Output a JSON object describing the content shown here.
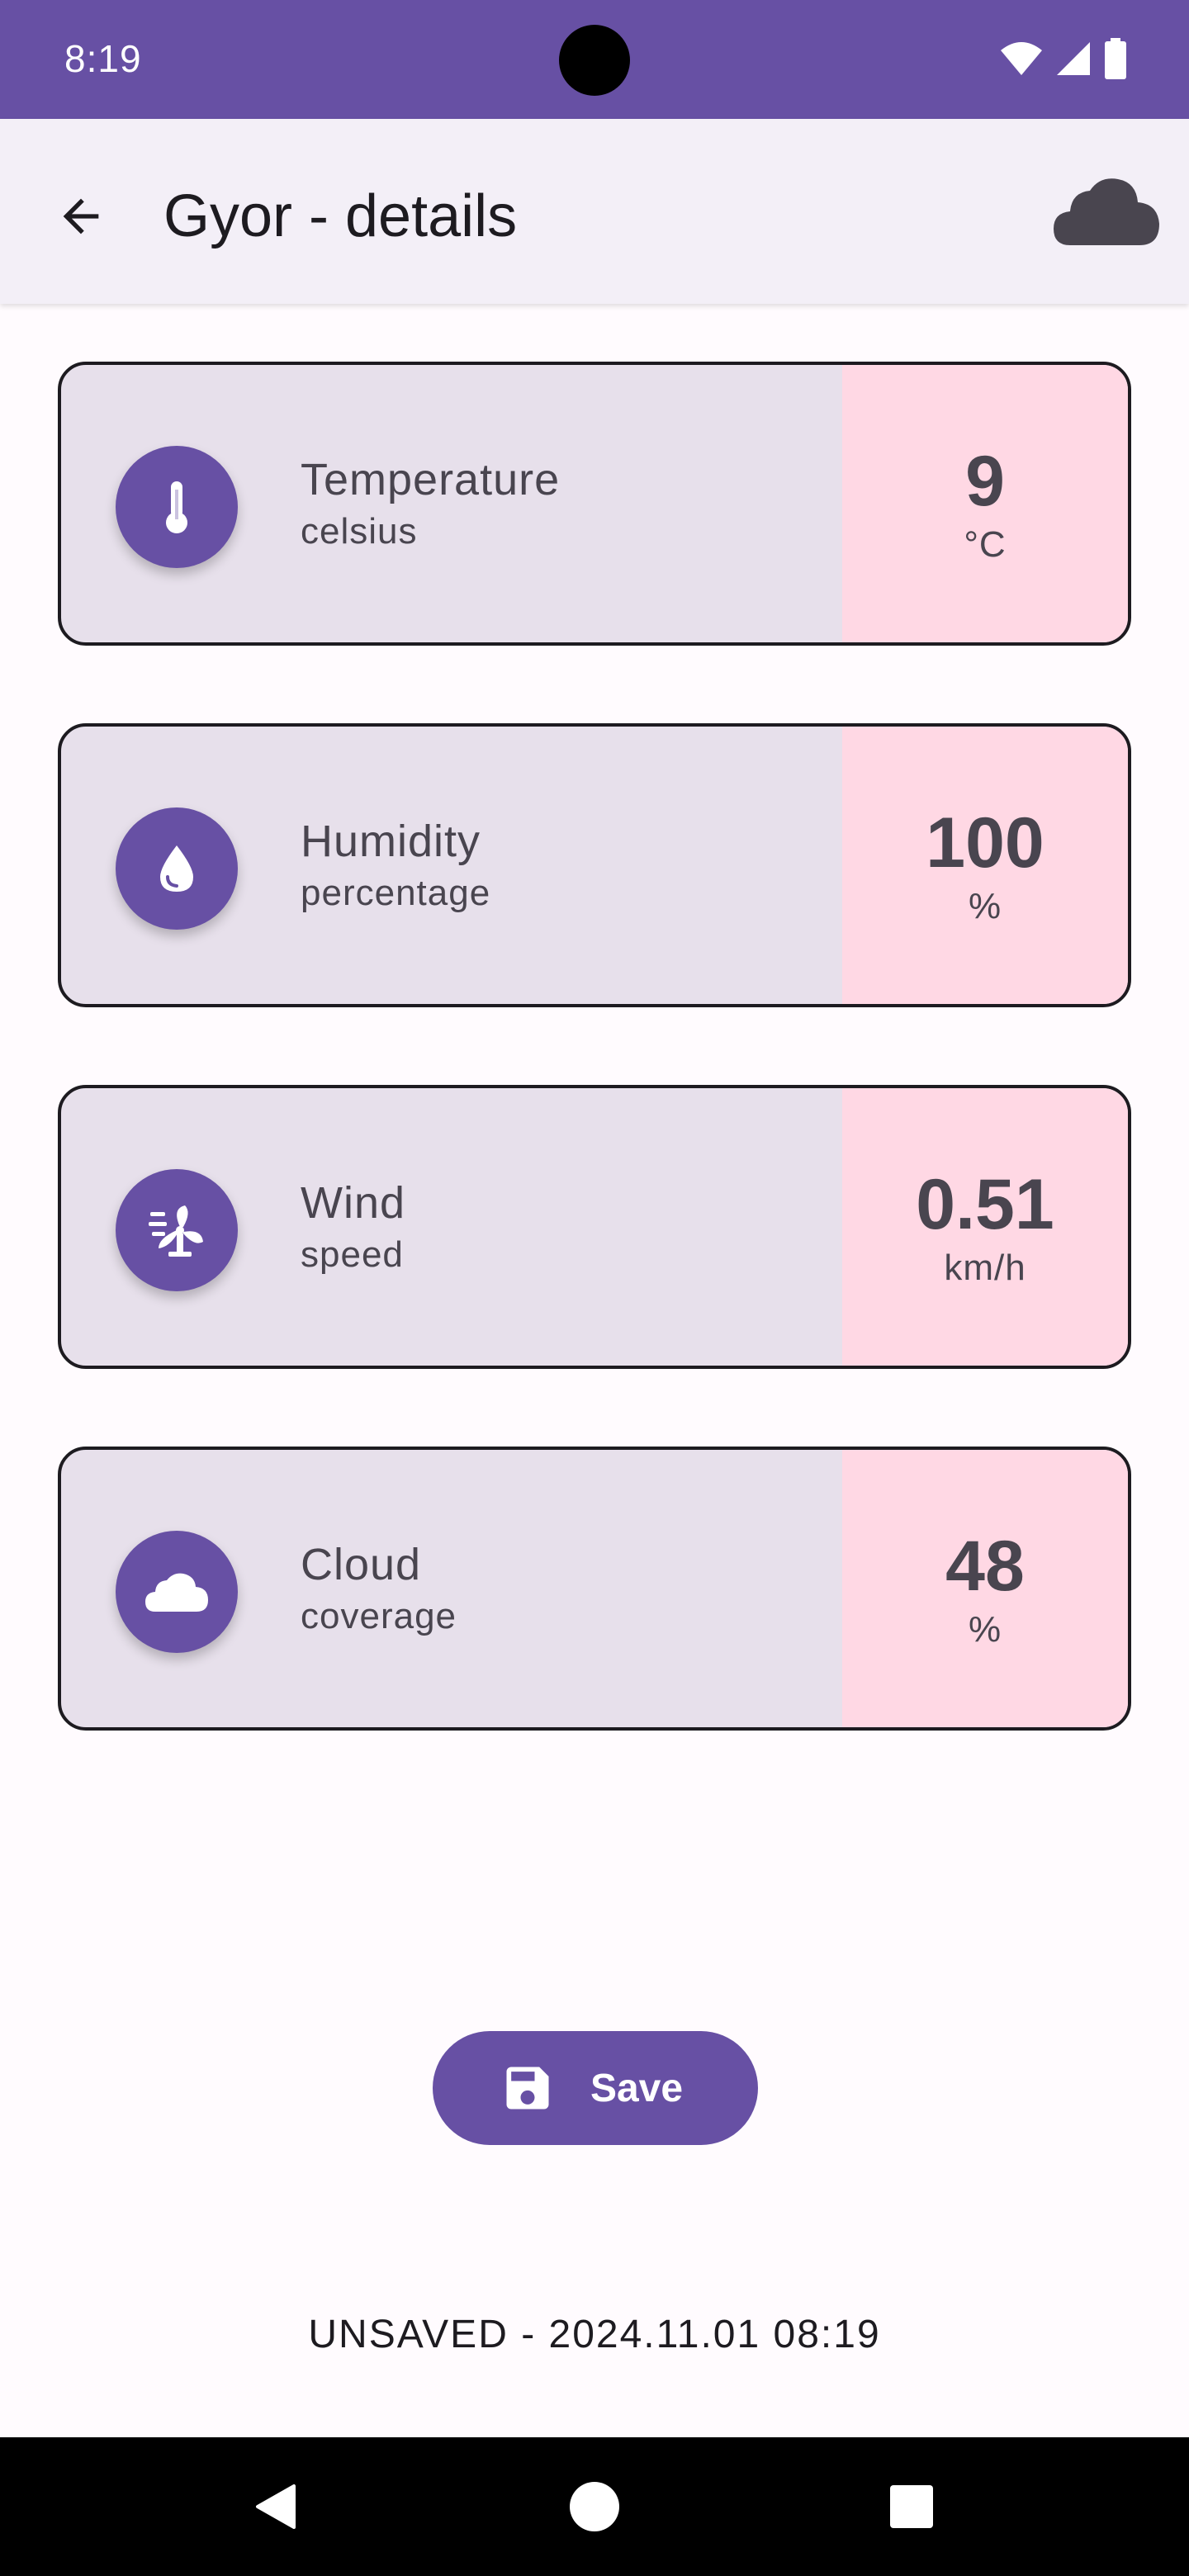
{
  "status_bar": {
    "time": "8:19",
    "icons": [
      "wifi-icon",
      "signal-icon",
      "battery-icon"
    ]
  },
  "app_bar": {
    "title": "Gyor - details",
    "back_icon": "arrow-back-icon",
    "action_icon": "cloud-icon"
  },
  "cards": [
    {
      "icon": "thermometer-icon",
      "title": "Temperature",
      "subtitle": "celsius",
      "value": "9",
      "unit": "°C"
    },
    {
      "icon": "water-drop-icon",
      "title": "Humidity",
      "subtitle": "percentage",
      "value": "100",
      "unit": "%"
    },
    {
      "icon": "wind-icon",
      "title": "Wind",
      "subtitle": "speed",
      "value": "0.51",
      "unit": "km/h"
    },
    {
      "icon": "cloud-icon",
      "title": "Cloud",
      "subtitle": "coverage",
      "value": "48",
      "unit": "%"
    }
  ],
  "save_button": {
    "label": "Save",
    "icon": "save-icon"
  },
  "save_status": "UNSAVED - 2024.11.01 08:19",
  "nav_bar": {
    "icons": [
      "back-triangle-icon",
      "home-circle-icon",
      "recents-square-icon"
    ]
  },
  "colors": {
    "primary": "#6750a4",
    "card_background": "#e7e0eb",
    "value_background": "#ffd8e4",
    "text": "#49454f"
  }
}
